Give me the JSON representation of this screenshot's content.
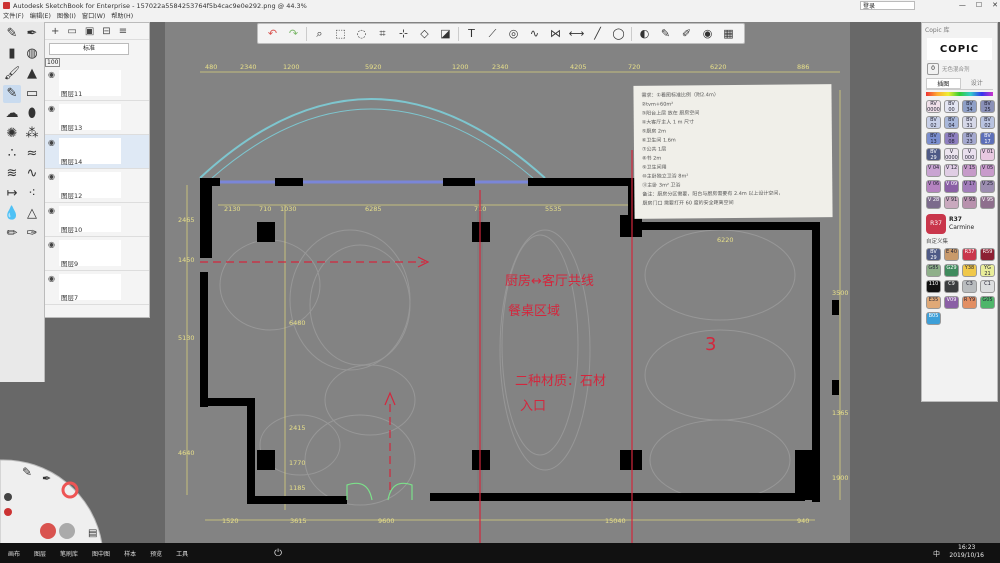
{
  "window": {
    "title": "Autodesk SketchBook for Enterprise - 157022a5584253764f5b4cac9e0e292.png @ 44.3%",
    "login_label": "登录",
    "controls": [
      "—",
      "☐",
      "✕"
    ]
  },
  "menu": [
    "文件(F)",
    "编辑(E)",
    "图像(I)",
    "窗口(W)",
    "帮助(H)"
  ],
  "toolbar": {
    "tools": [
      {
        "name": "undo-icon",
        "glyph": "↶"
      },
      {
        "name": "redo-icon",
        "glyph": "↷"
      },
      {
        "name": "zoom-icon",
        "glyph": "⌕"
      },
      {
        "name": "select-icon",
        "glyph": "⬚"
      },
      {
        "name": "lasso-icon",
        "glyph": "◌"
      },
      {
        "name": "crop-icon",
        "glyph": "⌗"
      },
      {
        "name": "transform-icon",
        "glyph": "⊹"
      },
      {
        "name": "distort-icon",
        "glyph": "◇"
      },
      {
        "name": "fill-icon",
        "glyph": "◪"
      },
      {
        "name": "text-icon",
        "glyph": "T"
      },
      {
        "name": "ruler-icon",
        "glyph": "⟋"
      },
      {
        "name": "ellipse-guide-icon",
        "glyph": "◎"
      },
      {
        "name": "french-curve-icon",
        "glyph": "∿"
      },
      {
        "name": "perspective-icon",
        "glyph": "⋈"
      },
      {
        "name": "symmetry-icon",
        "glyph": "⟷"
      },
      {
        "name": "line-icon",
        "glyph": "╱"
      },
      {
        "name": "shape-icon",
        "glyph": "◯"
      },
      {
        "name": "stroke-icon",
        "glyph": "◐"
      },
      {
        "name": "copic-library-icon",
        "glyph": "✎"
      },
      {
        "name": "brush-library-icon",
        "glyph": "✐"
      },
      {
        "name": "color-wheel-icon",
        "glyph": "◉"
      },
      {
        "name": "palette-icon",
        "glyph": "▦"
      }
    ]
  },
  "layers": {
    "blend_mode": "标准",
    "opacity": "100",
    "items": [
      {
        "label": "图层11",
        "selected": false
      },
      {
        "label": "图层13",
        "selected": false
      },
      {
        "label": "图层14",
        "selected": true
      },
      {
        "label": "图层12",
        "selected": false
      },
      {
        "label": "图层10",
        "selected": false
      },
      {
        "label": "图层9",
        "selected": false
      },
      {
        "label": "图层7",
        "selected": false
      }
    ]
  },
  "copic": {
    "header": "Copic 库",
    "logo": "COPIC",
    "tabs": [
      "插图",
      "设计"
    ],
    "search_placeholder": "无色混合剂",
    "colors_a": [
      {
        "code": "RV 0000",
        "color": "#f1e1ea"
      },
      {
        "code": "BV 00",
        "color": "#e3e5f2"
      },
      {
        "code": "BV 34",
        "color": "#8fa0c7"
      },
      {
        "code": "BV 25",
        "color": "#8b91b8"
      },
      {
        "code": "BV 02",
        "color": "#c8d0e8"
      },
      {
        "code": "BV 04",
        "color": "#a8b7da"
      },
      {
        "code": "BV 31",
        "color": "#d6d8e8"
      },
      {
        "code": "BV 02",
        "color": "#b9c3e0"
      },
      {
        "code": "BV 13",
        "color": "#7b8fd0"
      },
      {
        "code": "BV 08",
        "color": "#8e7fc0"
      },
      {
        "code": "BV 23",
        "color": "#a5a9cf"
      },
      {
        "code": "BV 17",
        "color": "#5d6fb8"
      },
      {
        "code": "BV 29",
        "color": "#4f5a86"
      },
      {
        "code": "V 0000",
        "color": "#ece4ef"
      },
      {
        "code": "V 000",
        "color": "#e9dfee"
      },
      {
        "code": "V 01",
        "color": "#e8c8e0"
      },
      {
        "code": "V 04",
        "color": "#c9a4d2"
      },
      {
        "code": "V 12",
        "color": "#e0cde4"
      },
      {
        "code": "V 15",
        "color": "#c69ac9"
      },
      {
        "code": "V 05",
        "color": "#c89bcb"
      },
      {
        "code": "V 06",
        "color": "#b583c0"
      },
      {
        "code": "V 09",
        "color": "#8a5fa5"
      },
      {
        "code": "V 17",
        "color": "#a27dba"
      },
      {
        "code": "V 25",
        "color": "#9c8db0"
      },
      {
        "code": "V 28",
        "color": "#7c6b8c"
      },
      {
        "code": "V 91",
        "color": "#c9a9be"
      },
      {
        "code": "V 93",
        "color": "#b891ad"
      },
      {
        "code": "V 95",
        "color": "#8e6f8d"
      }
    ],
    "current": {
      "code": "R37",
      "name": "Carmine",
      "color": "#c9364b"
    },
    "custom_header": "自定义集",
    "colors_b": [
      {
        "code": "BV 29",
        "color": "#4f5a86"
      },
      {
        "code": "E 40",
        "color": "#c99a6a"
      },
      {
        "code": "R37",
        "color": "#c9364b"
      },
      {
        "code": "R59",
        "color": "#8c2033"
      },
      {
        "code": "G85",
        "color": "#8fb08a"
      },
      {
        "code": "G29",
        "color": "#3f8a5d"
      },
      {
        "code": "Y38",
        "color": "#f0c84a"
      },
      {
        "code": "YG 21",
        "color": "#e9ee9a"
      },
      {
        "code": "110",
        "color": "#111111"
      },
      {
        "code": "C9",
        "color": "#3b3d3f"
      },
      {
        "code": "C3",
        "color": "#b9bcbe"
      },
      {
        "code": "C1",
        "color": "#dcdedf"
      },
      {
        "code": "E35",
        "color": "#e0a977"
      },
      {
        "code": "V09",
        "color": "#8a5fa5"
      },
      {
        "code": "R Y9",
        "color": "#e28f63"
      },
      {
        "code": "G05",
        "color": "#4fb56a"
      },
      {
        "code": "B05",
        "color": "#3d9fd8"
      }
    ]
  },
  "plan": {
    "top_dims": [
      "480",
      "2340",
      "1200",
      "5920",
      "1200",
      "2340",
      "4205",
      "720",
      "6220",
      "886"
    ],
    "inner_dims": [
      "2130",
      "710",
      "1030",
      "6285",
      "710",
      "5535",
      "6220"
    ],
    "left_dims": [
      "2465",
      "1450",
      "5130",
      "4640"
    ],
    "bottom_dims": [
      "1520",
      "3615",
      "9600",
      "15040",
      "940"
    ],
    "mid_dims": [
      "6480",
      "2415",
      "1770",
      "1185",
      "3500",
      "1365",
      "1900"
    ],
    "notes": [
      "需求：①看图标准比例（附2.4m）",
      "②tvm+60m²",
      "③阳台上层 放在 厨房空间",
      "④大客厅主人 1 m 尺寸",
      "⑤厨房 2m",
      "⑥卫生间 1.6m",
      "⑦公共 1层",
      "⑧书 2m",
      "⑨卫生间用",
      "⑩主卧独立卫浴 8m²",
      "⑪主卧 3m² 卫浴",
      "备注：厨房分区需要，阳台与厨房需要有 2.4m 以上设计空间，",
      "厨房门口 需要打开 60 度的安全距离空间"
    ],
    "red_annotations": [
      "厨房↔客厅共线",
      "餐桌区域",
      "3",
      "二种材质：石材",
      "入口"
    ]
  },
  "taskbar": {
    "items": [
      "画布",
      "图层",
      "笔刷库",
      "图中图",
      "样本",
      "预览",
      "工具"
    ],
    "time": "16:23",
    "date": "2019/10/16",
    "ime": "中"
  }
}
